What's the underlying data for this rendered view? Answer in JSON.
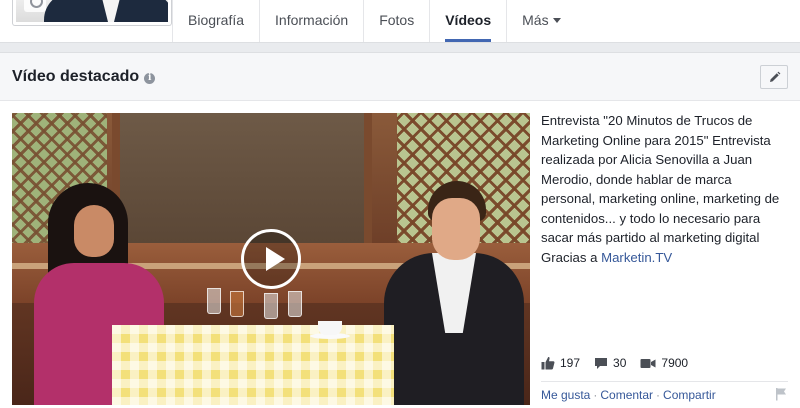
{
  "nav": {
    "tabs": [
      {
        "label": "Biografía",
        "active": false
      },
      {
        "label": "Información",
        "active": false
      },
      {
        "label": "Fotos",
        "active": false
      },
      {
        "label": "Vídeos",
        "active": true
      },
      {
        "label": "Más",
        "active": false
      }
    ]
  },
  "featured": {
    "title": "Vídeo destacado",
    "description": "Entrevista \"20 Minutos de Trucos de Marketing Online para 2015\" Entrevista realizada por Alicia Senovilla a Juan Merodio, donde hablar de marca personal, marketing online, marketing de contenidos... y todo lo necesario para sacar más partido al marketing digital\nGracias a ",
    "link_text": "Marketin.TV",
    "stats": {
      "likes": "197",
      "comments": "30",
      "views": "7900"
    },
    "actions": {
      "like": "Me gusta",
      "comment": "Comentar",
      "share": "Compartir",
      "separator": "·"
    }
  },
  "colors": {
    "link": "#365899",
    "active_tab_underline": "#4267b2",
    "page_bg": "#e9ebee",
    "icon_gray": "#4b4f56"
  }
}
